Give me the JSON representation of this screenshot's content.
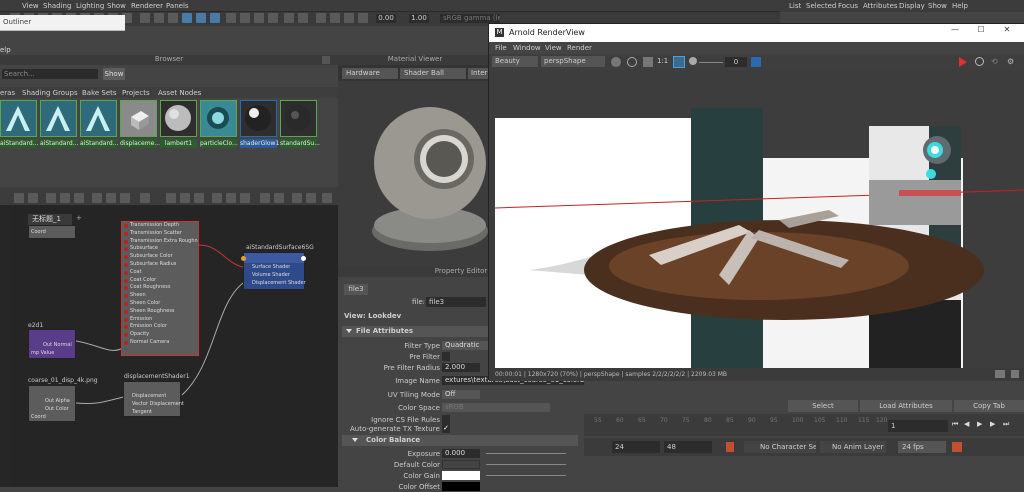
{
  "menubar": {
    "items": [
      "View",
      "Shading",
      "Lighting",
      "Show",
      "Renderer",
      "Panels"
    ]
  },
  "toolbar": {
    "field1": "0.00",
    "field2": "1.00",
    "field3": "sRGB gamma (legacy)"
  },
  "right_menubar": {
    "items": [
      "List",
      "Selected",
      "Focus",
      "Attributes",
      "Display",
      "Show",
      "Help"
    ]
  },
  "outliner": {
    "title": "Outliner",
    "help": "elp"
  },
  "browser": {
    "title": "Browser",
    "search_placeholder": "Search...",
    "show_button": "Show",
    "tabs": [
      "eras",
      "Shading Groups",
      "Bake Sets",
      "Projects",
      "Asset Nodes"
    ],
    "thumbs": [
      "aiStandard...",
      "aiStandard...",
      "aiStandard...",
      "displaceme...",
      "lambert1",
      "particleClo...",
      "shaderGlow1",
      "standardSu..."
    ]
  },
  "material_viewer": {
    "title": "Material Viewer",
    "renderer": "Hardware",
    "shape": "Shader Ball",
    "extra": "Interi"
  },
  "node_editor": {
    "tab": "无标题_1",
    "coord_label": "Coord",
    "big_node_rows": [
      "Transmission Depth",
      "Transmission Scatter",
      "Transmission Extra Roughness",
      "Subsurface",
      "Subsurface Color",
      "Subsurface Radius",
      "Coat",
      "Coat Color",
      "Coat Roughness",
      "Sheen",
      "Sheen Color",
      "Sheen Roughness",
      "Emission",
      "Emission Color",
      "Opacity",
      "Normal Camera"
    ],
    "sg_node": {
      "title": "aiStandardSurface6SG",
      "rows": [
        "Surface Shader",
        "Volume Shader",
        "Displacement Shader"
      ]
    },
    "bump_node": {
      "title": "e2d1",
      "rows": [
        "Out Normal",
        "mp Value"
      ]
    },
    "file_node": {
      "title": "coarse_01_disp_4k.png",
      "rows": [
        "Out Alpha",
        "Out Color",
        "Coord"
      ]
    },
    "disp_node": {
      "title": "displacementShader1",
      "rows": [
        "Displacement",
        "Vector Displacement",
        "Tangent"
      ]
    }
  },
  "property_editor": {
    "title": "Property Editor",
    "tab": "file3",
    "file_label": "file:",
    "file_value": "file3",
    "view_label": "View: Lookdev",
    "section1": "File Attributes",
    "rows": [
      {
        "label": "Filter Type",
        "value": "Quadratic"
      },
      {
        "label": "Pre Filter",
        "value": ""
      },
      {
        "label": "Pre Filter Radius",
        "value": "2.000"
      },
      {
        "label": "Image Name",
        "value": "extures\\textures\\dust_coarse_01_color2_4k.png"
      },
      {
        "label": "UV Tiling Mode",
        "value": "Off"
      },
      {
        "label": "Color Space",
        "value": "sRGB"
      },
      {
        "label": "Ignore CS File Rules",
        "value": ""
      },
      {
        "label": "Auto-generate TX Textures",
        "value": ""
      }
    ],
    "section2": "Color Balance",
    "rows2": [
      {
        "label": "Exposure",
        "value": "0.000"
      },
      {
        "label": "Default Color",
        "value": ""
      },
      {
        "label": "Color Gain",
        "value": ""
      },
      {
        "label": "Color Offset",
        "value": ""
      }
    ]
  },
  "render_view": {
    "title": "Arnold RenderView",
    "menu": [
      "File",
      "Window",
      "View",
      "Render"
    ],
    "aov": "Beauty",
    "camera": "perspShape",
    "ratio": "1:1",
    "exposure": "0",
    "status": "00:00:01 | 1280x720 (70%) | perspShape | samples 2/2/2/2/2/2 | 2209.03 MB"
  },
  "right_panel": {
    "select": "Select",
    "load_attributes": "Load Attributes",
    "copy_tab": "Copy Tab",
    "ruler": [
      "55",
      "60",
      "65",
      "70",
      "75",
      "80",
      "85",
      "90",
      "95",
      "100",
      "105",
      "110",
      "115",
      "120"
    ],
    "frame": "1",
    "start": "24",
    "end": "48",
    "char_set": "No Character Set",
    "anim_layer": "No Anim Layer",
    "fps": "24 fps"
  },
  "colors": {
    "accent_green": "#5aa84a",
    "node_red": "#b22222",
    "sg_blue": "#2f4a8a",
    "bump_purple": "#5a3d8a"
  }
}
